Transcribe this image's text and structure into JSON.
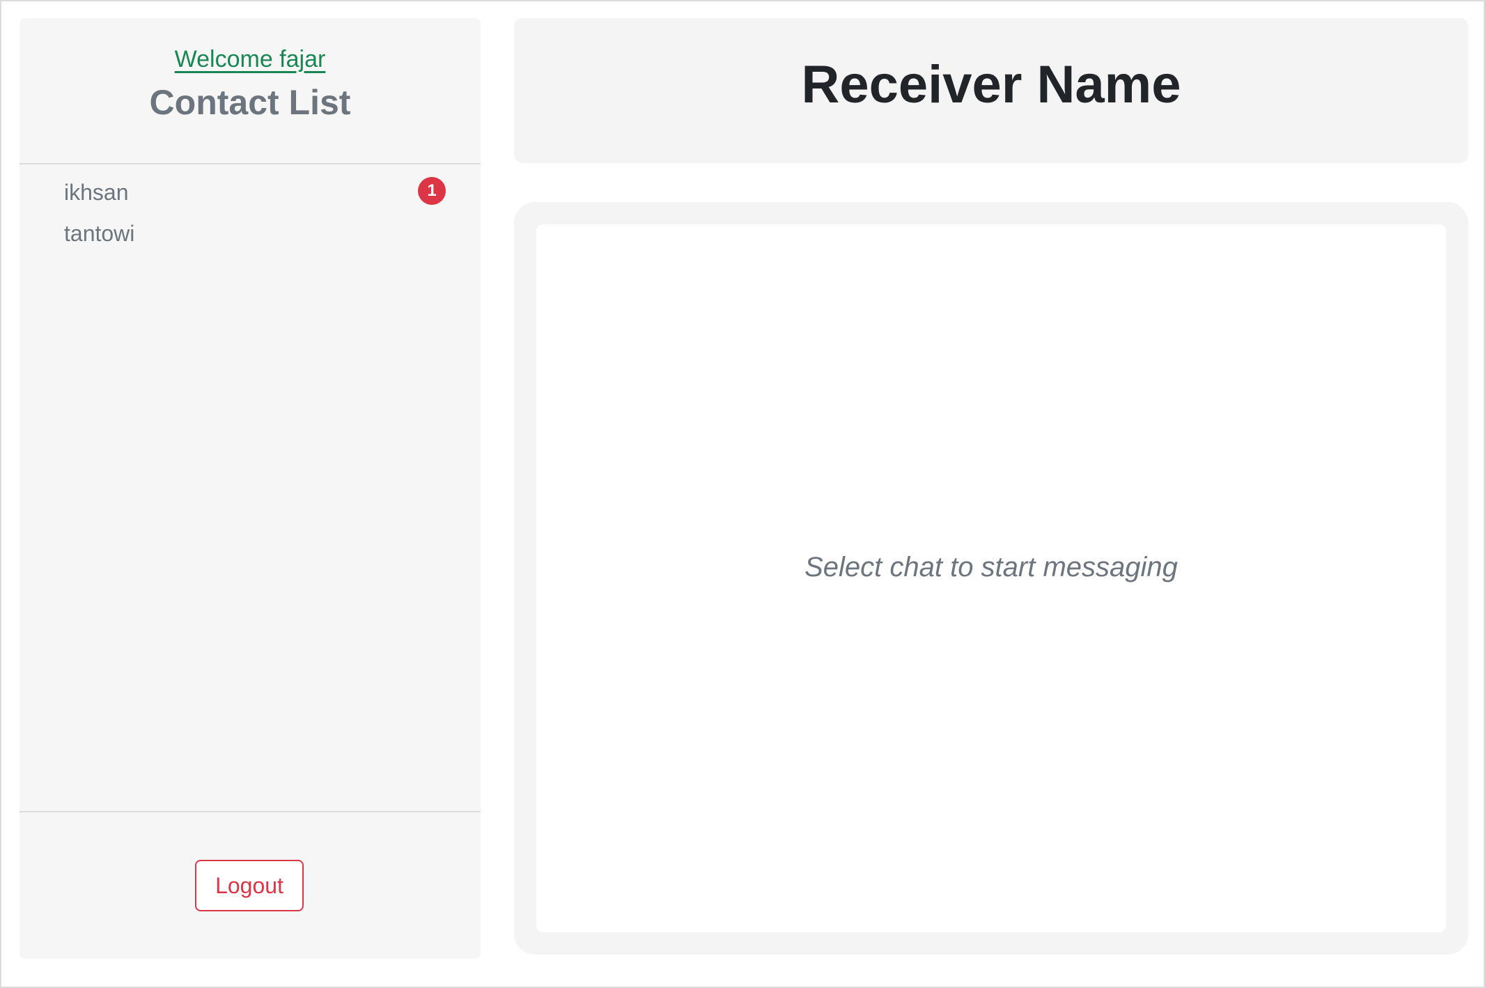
{
  "sidebar": {
    "welcome_link": "Welcome fajar",
    "title": "Contact List",
    "contacts": [
      {
        "name": "ikhsan",
        "unread_badge": "1"
      },
      {
        "name": "tantowi",
        "unread_badge": ""
      }
    ],
    "logout_label": "Logout"
  },
  "chat": {
    "receiver_name": "Receiver Name",
    "placeholder": "Select chat to start messaging"
  },
  "colors": {
    "welcome_link": "#198754",
    "badge": "#dc3545",
    "logout": "#dc3545",
    "muted_text": "#6c757d",
    "panel_background": "#f4f4f4"
  }
}
